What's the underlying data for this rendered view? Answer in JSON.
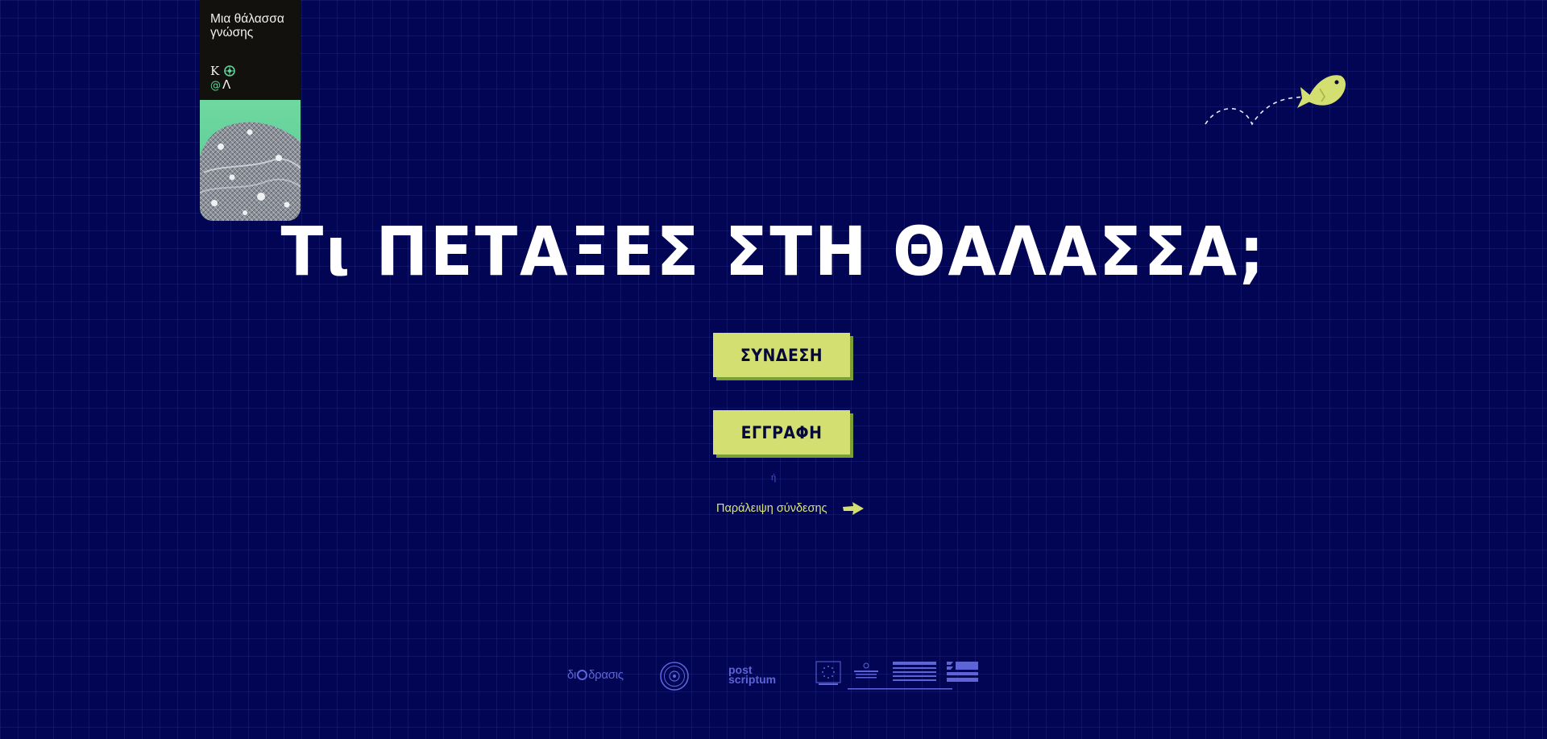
{
  "brand": {
    "title": "Μια θάλασσα γνώσης",
    "logo_icon": "kal-logo-icon",
    "image": "fishing-net-photo"
  },
  "hero": {
    "title": "Τι ΠΕΤΑΞΕΣ ΣΤΗ ΘΑΛΑΣΣΑ;"
  },
  "auth": {
    "login_label": "ΣΥΝΔΕΣΗ",
    "register_label": "ΕΓΓΡΑΦΗ",
    "or_label": "ή",
    "skip_label": "Παράλειψη σύνδεσης",
    "skip_icon": "arrow-right-icon"
  },
  "decoration": {
    "fish_icon": "fish-icon"
  },
  "partners": {
    "diadrasis_pre": "δι",
    "diadrasis_post": "δρασις",
    "post_line1": "post",
    "post_line2": "scriptum",
    "seal_icon": "partner-seal-icon",
    "funding_logos": "espa-funding-logos"
  },
  "colors": {
    "background": "#020553",
    "accent": "#d4df72",
    "accent_shadow": "#7aa033",
    "partner": "#5d64d8"
  }
}
